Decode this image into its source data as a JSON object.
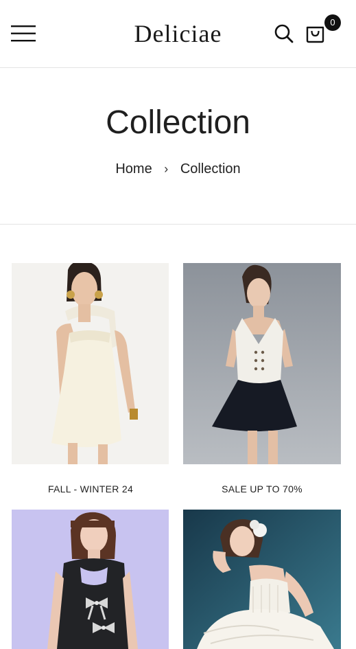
{
  "header": {
    "logo": "Deliciae",
    "cart_count": "0",
    "icons": [
      "menu-icon",
      "search-icon",
      "cart-icon"
    ]
  },
  "hero": {
    "title": "Collection",
    "breadcrumb": [
      {
        "label": "Home"
      },
      {
        "label": "Collection"
      }
    ],
    "separator": "›"
  },
  "collections": [
    {
      "label": "FALL - WINTER 24",
      "image": "model in cream strapless mini dress with scarf"
    },
    {
      "label": "SALE UP TO 70%",
      "image": "model in white halter vest and navy pleated skirt"
    },
    {
      "label": "",
      "image": "model in black dress with silver bow appliqués"
    },
    {
      "label": "",
      "image": "model in white tiered dress with flower hair clip"
    }
  ],
  "colors": {
    "text": "#222222",
    "badge": "#111111",
    "divider": "#e3e3e3"
  }
}
